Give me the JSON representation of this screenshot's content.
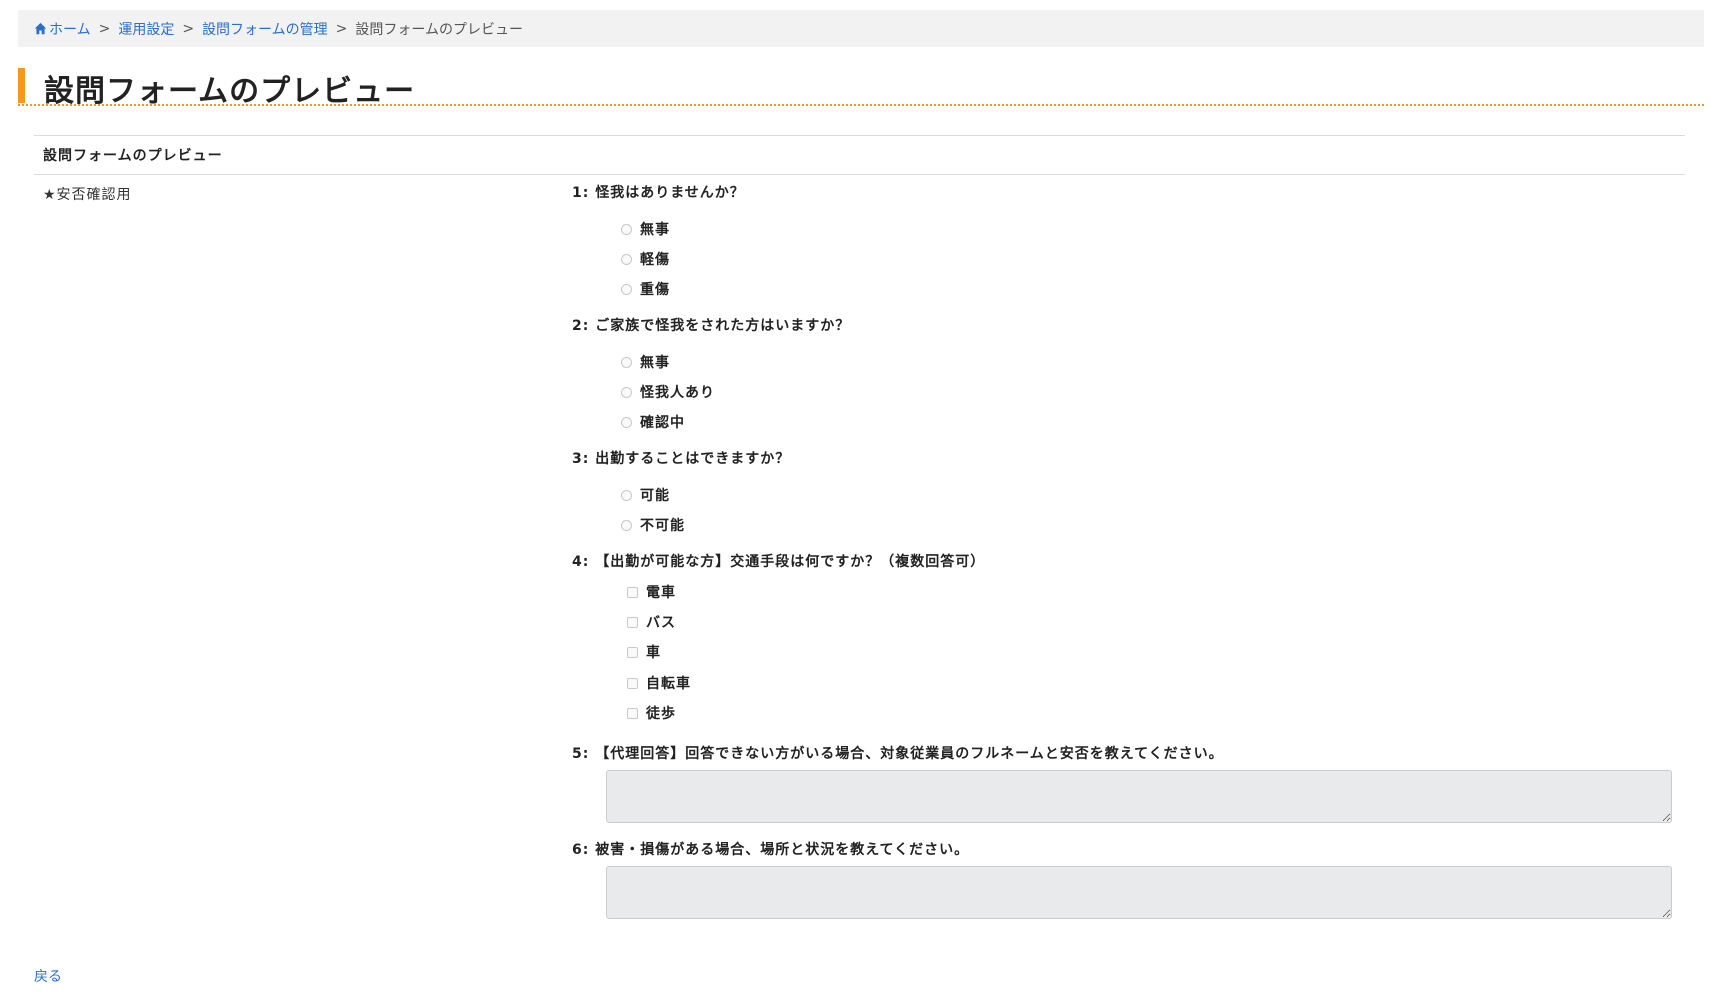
{
  "breadcrumb": {
    "home": "ホーム",
    "ops": "運用設定",
    "manage": "設問フォームの管理",
    "current": "設問フォームのプレビュー",
    "separator": ">"
  },
  "page": {
    "title": "設問フォームのプレビュー",
    "accent_color": "#f39a1e"
  },
  "panel": {
    "header": "設問フォームのプレビュー",
    "form_label": "★安否確認用"
  },
  "questions": [
    {
      "title": "1: 怪我はありませんか？",
      "type": "radio",
      "options": [
        "無事",
        "軽傷",
        "重傷"
      ]
    },
    {
      "title": "2: ご家族で怪我をされた方はいますか？",
      "type": "radio",
      "options": [
        "無事",
        "怪我人あり",
        "確認中"
      ]
    },
    {
      "title": "3: 出勤することはできますか？",
      "type": "radio",
      "options": [
        "可能",
        "不可能"
      ]
    },
    {
      "title": "4: 【出勤が可能な方】交通手段は何ですか？（複数回答可）",
      "type": "checkbox",
      "options": [
        "電車",
        "バス",
        "車",
        "自転車",
        "徒歩"
      ]
    },
    {
      "title": "5: 【代理回答】回答できない方がいる場合、対象従業員のフルネームと安否を教えてください。",
      "type": "textarea",
      "value": ""
    },
    {
      "title": "6: 被害・損傷がある場合、場所と状況を教えてください。",
      "type": "textarea",
      "value": ""
    }
  ],
  "footer": {
    "back": "戻る"
  }
}
